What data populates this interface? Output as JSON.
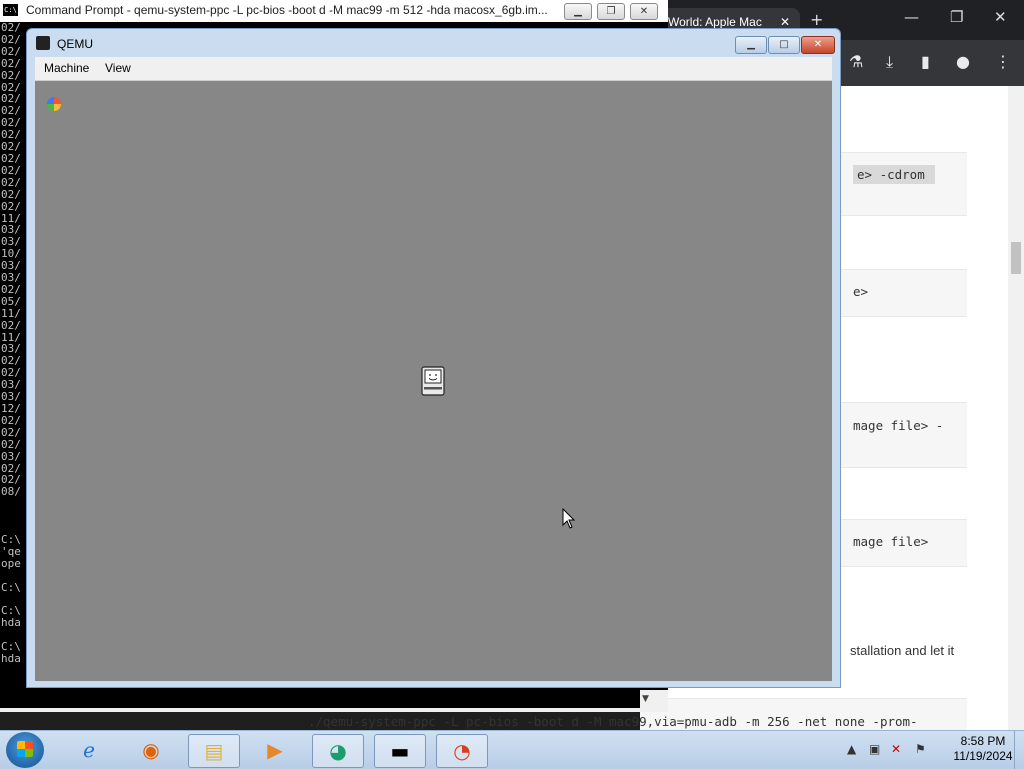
{
  "browser": {
    "tab_title": "World: Apple Mac",
    "tab_close": "✕",
    "new_tab": "+",
    "code_snippets": [
      "e> -cdrom",
      "e>",
      "mage file> -",
      "mage file>"
    ],
    "text_snippet": "stallation and let it",
    "bottom_command": "./qemu-system-ppc -L pc-bios -boot d -M mac99,via=pmu-adb -m 256 -net none -prom-"
  },
  "cmd": {
    "title": "Command Prompt - qemu-system-ppc  -L pc-bios -boot d -M mac99 -m 512 -hda macosx_6gb.im...",
    "icon_text": "C:\\",
    "lines": [
      "02/",
      "02/",
      "02/",
      "02/",
      "02/",
      "02/",
      "02/",
      "02/",
      "02/",
      "02/",
      "02/",
      "02/",
      "02/",
      "02/",
      "02/",
      "02/",
      "11/",
      "03/",
      "03/",
      "10/",
      "03/",
      "03/",
      "02/",
      "05/",
      "11/",
      "02/",
      "11/",
      "03/",
      "02/",
      "02/",
      "03/",
      "03/",
      "12/",
      "02/",
      "02/",
      "02/",
      "03/",
      "02/",
      "02/",
      "08/",
      "",
      "",
      "",
      "C:\\",
      "'qe",
      "ope",
      "",
      "C:\\",
      "",
      "C:\\",
      "hda",
      "",
      "C:\\",
      "hda"
    ]
  },
  "qemu": {
    "title": "QEMU",
    "menu": {
      "machine": "Machine",
      "view": "View"
    }
  },
  "taskbar": {
    "clock_time": "8:58 PM",
    "clock_date": "11/19/2024"
  },
  "colors": {
    "qemu_screen": "#878787",
    "qemu_frame": "#c9dcf0",
    "taskbar": "#c3d6ec"
  }
}
